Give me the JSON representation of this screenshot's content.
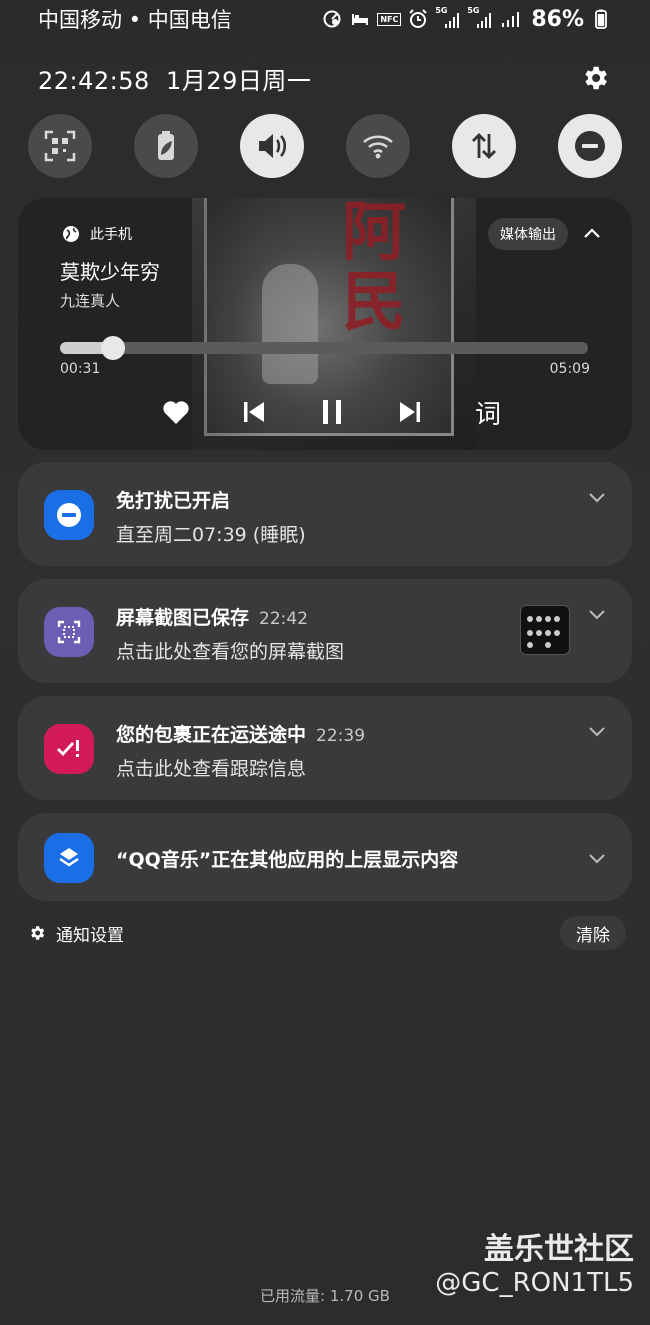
{
  "status_bar": {
    "carriers": "中国移动 • 中国电信",
    "icons": [
      "data-saver-icon",
      "sleep-mode-icon",
      "nfc-icon",
      "alarm-icon",
      "5g-signal-icon",
      "5g-signal-icon",
      "signal-icon"
    ],
    "nfc_label": "NFC",
    "net_label_1": "5G",
    "net_label_2": "5G",
    "battery_pct": "86%"
  },
  "header": {
    "time_date": "22:42:58  1月29日周一",
    "settings_icon": "gear-icon"
  },
  "quick_settings": [
    {
      "name": "qr-scan",
      "icon": "qr-scan-icon",
      "on": false
    },
    {
      "name": "power-saving",
      "icon": "battery-leaf-icon",
      "on": false
    },
    {
      "name": "sound",
      "icon": "speaker-icon",
      "on": true
    },
    {
      "name": "wifi",
      "icon": "wifi-icon",
      "on": false
    },
    {
      "name": "mobile-data",
      "icon": "data-arrows-icon",
      "on": true
    },
    {
      "name": "do-not-disturb",
      "icon": "dnd-minus-icon",
      "on": true
    }
  ],
  "media": {
    "source": "此手机",
    "title": "莫欺少年穷",
    "artist": "九连真人",
    "output_button": "媒体输出",
    "elapsed": "00:31",
    "total": "05:09",
    "progress_fraction": 0.1,
    "lyrics_button": "词",
    "album_text": "阿民"
  },
  "notifications": [
    {
      "title": "免打扰已开启",
      "time": "",
      "body": "直至周二07:39 (睡眠)",
      "icon": "dnd-minus-icon",
      "color": "#1b6fe6"
    },
    {
      "title": "屏幕截图已保存",
      "time": "22:42",
      "body": "点击此处查看您的屏幕截图",
      "icon": "screenshot-icon",
      "color": "#6a5fb4"
    },
    {
      "title": "您的包裹正在运送途中",
      "time": "22:39",
      "body": "点击此处查看跟踪信息",
      "icon": "package-alert-icon",
      "color": "#d21b56"
    },
    {
      "title": "“QQ音乐”正在其他应用的上层显示内容",
      "time": "",
      "body": "",
      "icon": "layers-icon",
      "color": "#1b6fe6"
    }
  ],
  "footer": {
    "notif_settings": "通知设置",
    "clear": "清除",
    "data_usage": "已用流量: 1.70 GB"
  },
  "watermark": {
    "brand": "盖乐世社区",
    "user": "@GC_RON1TL5"
  }
}
